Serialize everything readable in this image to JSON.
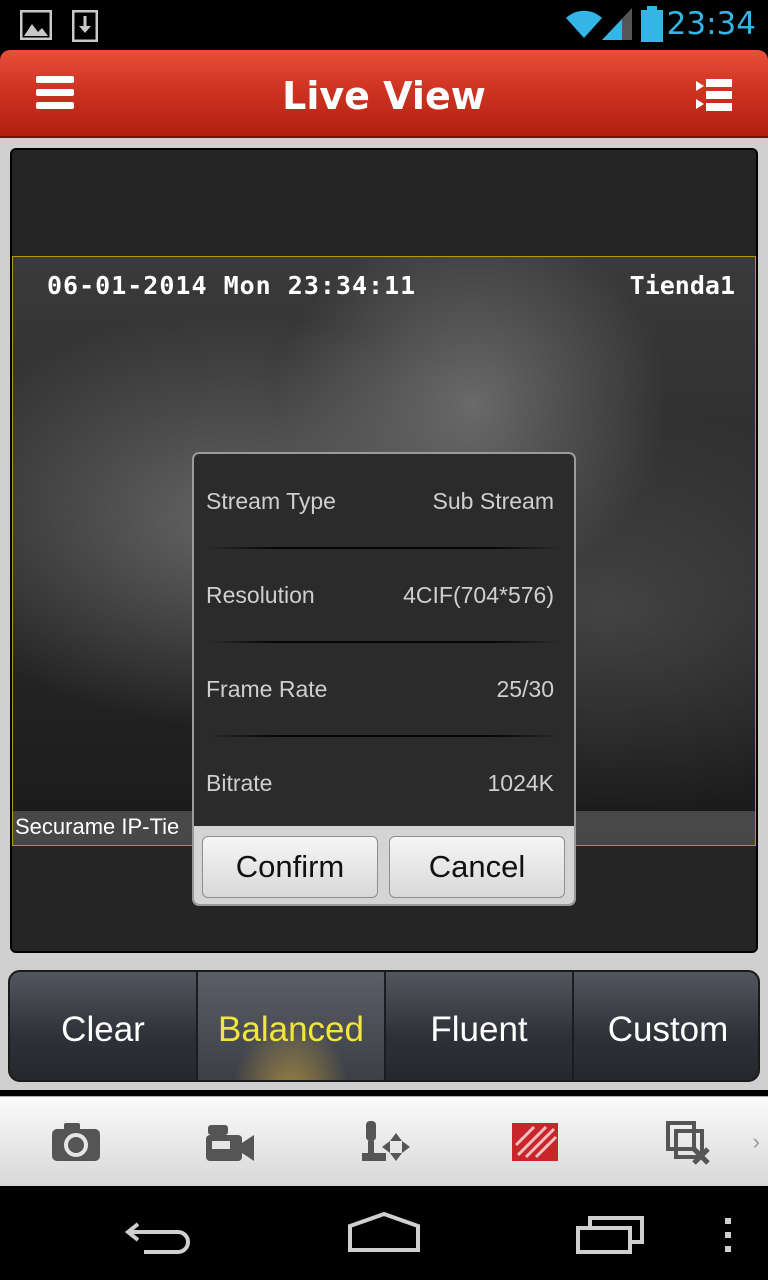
{
  "status_bar": {
    "time": "23:34",
    "left_icons": [
      "image-icon",
      "download-icon"
    ],
    "right_icons": [
      "wifi-icon",
      "signal-icon",
      "battery-icon"
    ]
  },
  "header": {
    "title": "Live View",
    "menu_icon": "menu-icon",
    "list_icon": "list-icon"
  },
  "camera": {
    "datetime": "06-01-2014 Mon 23:34:11",
    "channel_label": "Tienda1",
    "name": "Securame IP-Tie"
  },
  "dialog": {
    "rows": [
      {
        "label": "Stream Type",
        "value": "Sub Stream"
      },
      {
        "label": "Resolution",
        "value": "4CIF(704*576)"
      },
      {
        "label": "Frame Rate",
        "value": "25/30"
      },
      {
        "label": "Bitrate",
        "value": "1024K"
      }
    ],
    "confirm_label": "Confirm",
    "cancel_label": "Cancel"
  },
  "quality": {
    "options": [
      "Clear",
      "Balanced",
      "Fluent",
      "Custom"
    ],
    "selected": "Balanced"
  },
  "toolbar": {
    "icons": [
      "camera-icon",
      "video-record-icon",
      "ptz-icon",
      "quality-icon",
      "close-all-icon"
    ]
  },
  "nav": {
    "icons": [
      "back-icon",
      "home-icon",
      "recent-apps-icon",
      "more-icon"
    ]
  }
}
